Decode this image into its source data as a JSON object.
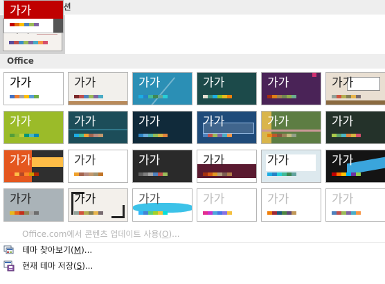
{
  "sections": {
    "current": "현재 프레젠테이션",
    "office": "Office"
  },
  "thumb_title": "가가",
  "menu": {
    "update": {
      "label": "Office.com에서 콘텐츠 업데이트 사용(",
      "key": "O",
      "suffix": ")..."
    },
    "browse": {
      "label": "테마 찾아보기(",
      "key": "M",
      "suffix": ")..."
    },
    "save": {
      "label": "현재 테마 저장(",
      "key": "S",
      "suffix": ")..."
    }
  },
  "themes": [
    {
      "name": "current",
      "bg": "#f5f2ee",
      "text": "#222222",
      "swatches": [
        "#5b4f9c",
        "#c0504d",
        "#3c8fc8",
        "#9bbb59",
        "#8064a2",
        "#4bacc6",
        "#f79646",
        "#d64f6b"
      ]
    },
    {
      "name": "office-theme",
      "bg": "#ffffff",
      "text": "#000000",
      "swatches": [
        "#4472c4",
        "#ed7d31",
        "#a5a5a5",
        "#ffc000",
        "#5b9bd5",
        "#70ad47"
      ]
    },
    {
      "name": "theme-2",
      "bg": "#f2f0ec",
      "text": "#222222",
      "swatches": [
        "#7b2a2a",
        "#c0504d",
        "#4f81bd",
        "#9bbb59",
        "#8064a2",
        "#4bacc6"
      ]
    },
    {
      "name": "theme-3",
      "bg": "#2b8fb5",
      "text": "#ffffff",
      "swatches": [
        "#1cade4",
        "#2683c6",
        "#42ba97",
        "#3e8853",
        "#62a39f",
        "#27ced7"
      ]
    },
    {
      "name": "theme-4",
      "bg": "#1c4a4a",
      "text": "#ffffff",
      "swatches": [
        "#e3ded1",
        "#3b8c78",
        "#1cade4",
        "#90c226",
        "#e6b91e",
        "#f07f09"
      ]
    },
    {
      "name": "theme-5",
      "bg": "#4a2357",
      "text": "#ffffff",
      "swatches": [
        "#a53010",
        "#de7e18",
        "#9f8351",
        "#728653",
        "#92aa4c",
        "#6aac91"
      ]
    },
    {
      "name": "theme-6",
      "bg": "#e9dfd2",
      "text": "#222222",
      "swatches": [
        "#93a299",
        "#cf543f",
        "#b5ae53",
        "#848058",
        "#e8b54d",
        "#786c71"
      ]
    },
    {
      "name": "theme-7",
      "bg": "#9bbb29",
      "text": "#ffffff",
      "swatches": [
        "#549e39",
        "#8ab833",
        "#c0cf3a",
        "#029676",
        "#4ab5c4",
        "#0989b1"
      ]
    },
    {
      "name": "theme-8",
      "bg": "#1c4d59",
      "text": "#ffffff",
      "swatches": [
        "#1cade4",
        "#42ba97",
        "#f0a22e",
        "#a5644e",
        "#b58b80",
        "#c3986d"
      ]
    },
    {
      "name": "theme-9",
      "bg": "#102a3a",
      "text": "#ffffff",
      "swatches": [
        "#2e83c3",
        "#6aa9d8",
        "#4bb0a6",
        "#8fbc5a",
        "#d5b340",
        "#e0823d"
      ]
    },
    {
      "name": "theme-10",
      "bg": "#1f4b7a",
      "text": "#ffffff",
      "swatches": [
        "#4f81bd",
        "#c0504d",
        "#9bbb59",
        "#8064a2",
        "#4bacc6",
        "#f79646"
      ]
    },
    {
      "name": "theme-11",
      "bg": "#5d7d43",
      "text": "#ffffff",
      "swatches": [
        "#e48312",
        "#bd582c",
        "#865640",
        "#9b8357",
        "#c2bc80",
        "#94a088"
      ]
    },
    {
      "name": "theme-12",
      "bg": "#24322a",
      "text": "#ffffff",
      "swatches": [
        "#a9c94a",
        "#5da36b",
        "#4ab5c4",
        "#e0823d",
        "#d5b340",
        "#d64f6b"
      ]
    },
    {
      "name": "theme-13",
      "bg": "#2f2f2f",
      "text": "#ffffff",
      "swatches": [
        "#e84c22",
        "#ffbd47",
        "#b64926",
        "#ff8427",
        "#cc9900",
        "#b22600"
      ]
    },
    {
      "name": "theme-14",
      "bg": "#ffffff",
      "text": "#333333",
      "swatches": [
        "#f0a22e",
        "#a5644e",
        "#b58b80",
        "#c3986d",
        "#a19574",
        "#c17529"
      ]
    },
    {
      "name": "theme-15",
      "bg": "#2a2a2a",
      "text": "#ffffff",
      "swatches": [
        "#5f5f5f",
        "#7f7f7f",
        "#a5a5a5",
        "#4f81bd",
        "#c0504d",
        "#9bbb59"
      ]
    },
    {
      "name": "theme-16",
      "bg": "#ffffff",
      "text": "#222222",
      "swatches": [
        "#a5300f",
        "#d55816",
        "#e19825",
        "#b19c7d",
        "#7f5f52",
        "#b27d49"
      ]
    },
    {
      "name": "theme-17",
      "bg": "#dde9ee",
      "text": "#222222",
      "swatches": [
        "#1cade4",
        "#2683c6",
        "#27ced7",
        "#42ba97",
        "#3e8853",
        "#62a39f"
      ]
    },
    {
      "name": "theme-18",
      "bg": "#141414",
      "text": "#ffffff",
      "swatches": [
        "#c00000",
        "#ff6f00",
        "#ffc000",
        "#00b0f0",
        "#7030a0",
        "#92d050"
      ]
    },
    {
      "name": "theme-19",
      "bg": "#aab3b8",
      "text": "#222222",
      "swatches": [
        "#e6b91e",
        "#e76618",
        "#c42f1a",
        "#918655",
        "#a5a5a5",
        "#6d6d6d"
      ]
    },
    {
      "name": "theme-20",
      "bg": "#f3f0eb",
      "text": "#000000",
      "swatches": [
        "#93a299",
        "#cf543f",
        "#b5ae53",
        "#848058",
        "#e8b54d",
        "#786c71"
      ]
    },
    {
      "name": "theme-21",
      "bg": "#ffffff",
      "text": "#555555",
      "swatches": [
        "#31b6fd",
        "#4584d3",
        "#5bd078",
        "#a5d028",
        "#f5c040",
        "#05e0db"
      ]
    },
    {
      "name": "theme-22",
      "bg": "#ffffff",
      "text": "#bbbbbb",
      "swatches": [
        "#e32d91",
        "#c830cc",
        "#4ea6dc",
        "#4775e7",
        "#8971e1",
        "#f5c040"
      ]
    },
    {
      "name": "theme-23",
      "bg": "#ffffff",
      "text": "#bbbbbb",
      "swatches": [
        "#f07f09",
        "#9f2936",
        "#1b587c",
        "#4e8542",
        "#604878",
        "#c19859"
      ]
    },
    {
      "name": "theme-24",
      "bg": "#ffffff",
      "text": "#bbbbbb",
      "swatches": [
        "#4f81bd",
        "#c0504d",
        "#9bbb59",
        "#8064a2",
        "#4bacc6",
        "#f79646"
      ]
    },
    {
      "name": "theme-25",
      "bg": "#ffffff",
      "text": "#ffffff",
      "swatches": [
        "#c00000",
        "#e46c0a",
        "#ffc000",
        "#4f81bd",
        "#9bbb59",
        "#8064a2"
      ]
    }
  ]
}
